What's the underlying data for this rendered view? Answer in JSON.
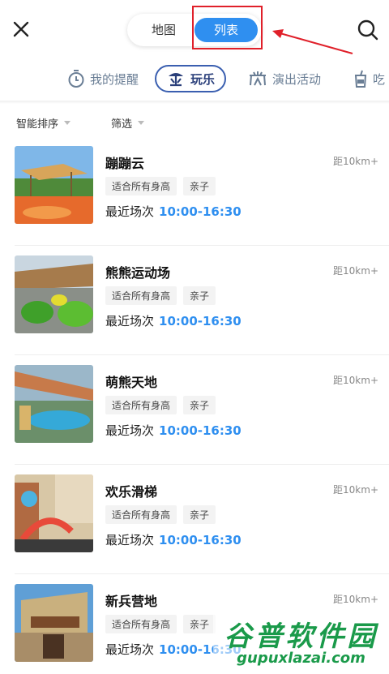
{
  "header": {
    "segment": {
      "map_label": "地图",
      "list_label": "列表",
      "selected": "列表"
    }
  },
  "categories": [
    {
      "label": "我的提醒",
      "icon": "stopwatch-icon"
    },
    {
      "label": "玩乐",
      "icon": "playground-icon",
      "active": true
    },
    {
      "label": "演出活动",
      "icon": "performance-icon"
    },
    {
      "label": "吃",
      "icon": "drink-icon"
    }
  ],
  "filters": {
    "sort_label": "智能排序",
    "filter_label": "筛选"
  },
  "items": [
    {
      "name": "蹦蹦云",
      "distance": "距10km+",
      "tags": [
        "适合所有身高",
        "亲子"
      ],
      "time_label": "最近场次",
      "time": "10:00-16:30"
    },
    {
      "name": "熊熊运动场",
      "distance": "距10km+",
      "tags": [
        "适合所有身高",
        "亲子"
      ],
      "time_label": "最近场次",
      "time": "10:00-16:30"
    },
    {
      "name": "萌熊天地",
      "distance": "距10km+",
      "tags": [
        "适合所有身高",
        "亲子"
      ],
      "time_label": "最近场次",
      "time": "10:00-16:30"
    },
    {
      "name": "欢乐滑梯",
      "distance": "距10km+",
      "tags": [
        "适合所有身高",
        "亲子"
      ],
      "time_label": "最近场次",
      "time": "10:00-16:30"
    },
    {
      "name": "新兵营地",
      "distance": "距10km+",
      "tags": [
        "适合所有身高",
        "亲子"
      ],
      "time_label": "最近场次",
      "time": "10:00-16:30"
    }
  ],
  "watermark": {
    "cn": "谷普软件园",
    "en": "gupuxlazai.com"
  },
  "colors": {
    "accent": "#2f8ff0",
    "highlight": "#e0202a",
    "category_active": "#2a3f7a",
    "watermark": "#1a9a4a"
  }
}
